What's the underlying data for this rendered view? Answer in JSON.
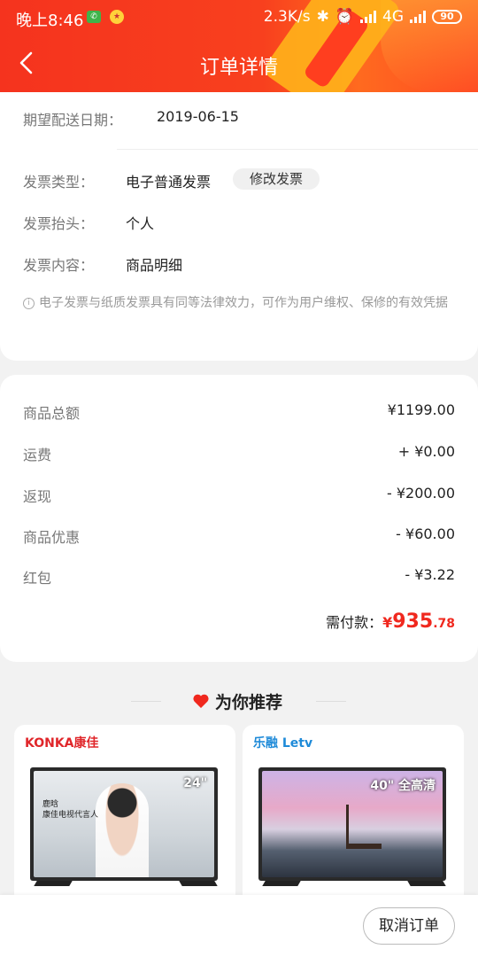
{
  "status_bar": {
    "time": "晚上8:46",
    "speed": "2.3K/s",
    "network": "4G",
    "battery": "90"
  },
  "header": {
    "title": "订单详情",
    "back_icon": "chevron-left-icon"
  },
  "delivery": {
    "label": "期望配送日期：",
    "value": "2019-06-15"
  },
  "invoice": {
    "type_label": "发票类型：",
    "type_value": "电子普通发票",
    "edit_button": "修改发票",
    "title_label": "发票抬头：",
    "title_value": "个人",
    "content_label": "发票内容：",
    "content_value": "商品明细",
    "note": "电子发票与纸质发票具有同等法律效力，可作为用户维权、保修的有效凭据"
  },
  "amounts": {
    "rows": [
      {
        "label": "商品总额",
        "value": "¥1199.00"
      },
      {
        "label": "运费",
        "value": "+ ¥0.00"
      },
      {
        "label": "返现",
        "value": "- ¥200.00"
      },
      {
        "label": "商品优惠",
        "value": "- ¥60.00"
      },
      {
        "label": "红包",
        "value": "- ¥3.22"
      }
    ],
    "need_pay_label": "需付款：",
    "need_pay_currency": "¥",
    "need_pay_int": "935",
    "need_pay_dec": ".78"
  },
  "recommend": {
    "title": "为你推荐",
    "products": [
      {
        "brand": "KONKA康佳",
        "size": "24\"",
        "caption_line1": "鹿晗",
        "caption_line2": "康佳电视代言人"
      },
      {
        "brand": "乐融 Letv",
        "size": "40\" 全高清"
      }
    ]
  },
  "bottom": {
    "cancel_button": "取消订单"
  },
  "colors": {
    "accent": "#f0281e",
    "header": "#f5331e"
  }
}
